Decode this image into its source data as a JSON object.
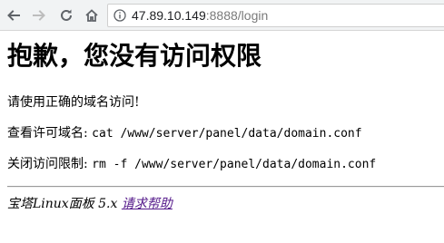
{
  "browser": {
    "url_host": "47.89.10.149",
    "url_rest": ":8888/login",
    "icons": {
      "back": "arrow-left-icon",
      "forward": "arrow-right-icon",
      "reload": "reload-icon",
      "home": "home-icon",
      "info": "info-icon"
    }
  },
  "page": {
    "heading": "抱歉，您没有访问权限",
    "line1": "请使用正确的域名访问!",
    "line2_label": "查看许可域名: ",
    "line2_cmd": "cat /www/server/panel/data/domain.conf",
    "line3_label": "关闭访问限制: ",
    "line3_cmd": "rm -f /www/server/panel/data/domain.conf",
    "footer_text": "宝塔Linux面板 5.x ",
    "help_link": "请求帮助",
    "link_color": "#551a8b"
  }
}
